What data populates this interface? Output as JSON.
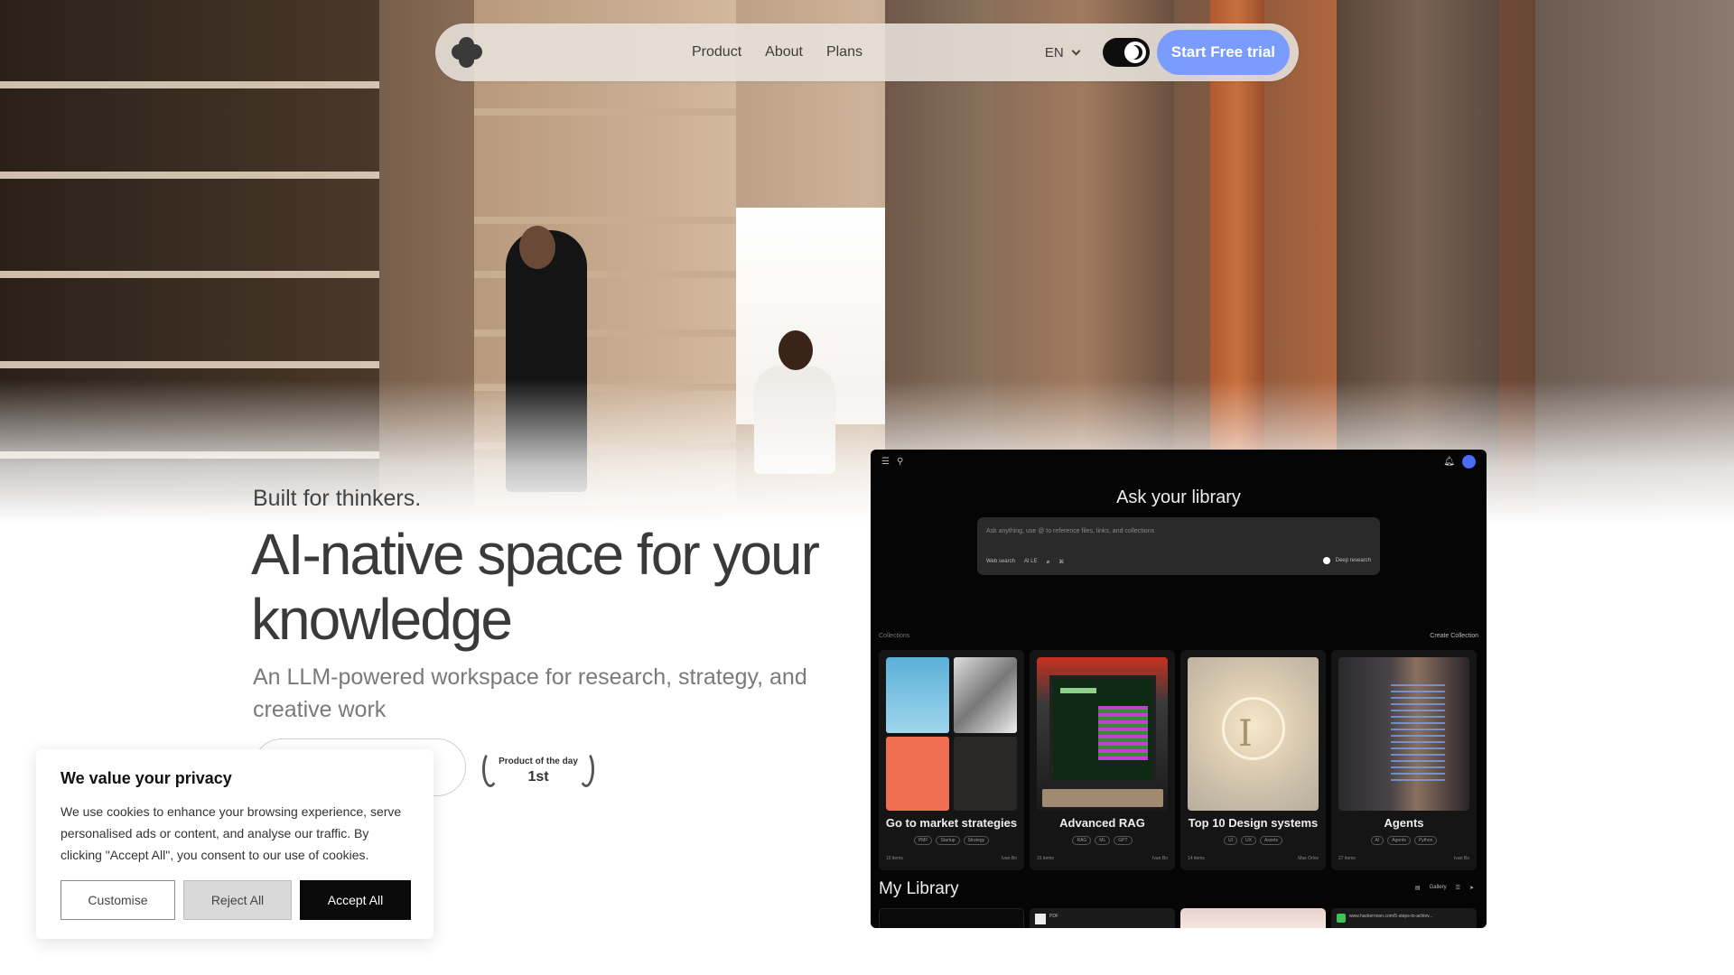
{
  "nav": {
    "links": [
      "Product",
      "About",
      "Plans"
    ],
    "language": "EN",
    "cta_label": "Start Free trial"
  },
  "hero": {
    "eyebrow": "Built for thinkers.",
    "headline": "AI-native space for your knowledge",
    "subtitle": "An LLM-powered workspace for research, strategy, and creative work",
    "award_line1": "Product of the day",
    "award_line2": "1st"
  },
  "app_preview": {
    "ask_title": "Ask your library",
    "ask_placeholder": "Ask anything, use @ to reference files, links, and collections",
    "tools": [
      "Web search",
      "AI LE",
      "⌘"
    ],
    "deep_research": "Deep research",
    "collections_label": "Collections",
    "create_collection": "Create Collection",
    "cards": [
      {
        "title": "Go to market strategies",
        "tags": [
          "PMF",
          "Startup",
          "Strategy"
        ],
        "count": "10 items",
        "owner": "Ivan Bo"
      },
      {
        "title": "Advanced RAG",
        "tags": [
          "RAG",
          "ML",
          "GPT"
        ],
        "count": "15 items",
        "owner": "Ivan Bo"
      },
      {
        "title": "Top 10 Design systems",
        "tags": [
          "UI",
          "UX",
          "Assets"
        ],
        "count": "14 items",
        "owner": "Max Orlov"
      },
      {
        "title": "Agents",
        "tags": [
          "AI",
          "Agents",
          "Python"
        ],
        "count": "27 items",
        "owner": "Ivan Bo"
      }
    ],
    "my_library": "My Library",
    "gallery_label": "Gallery",
    "lib_items": [
      "",
      "PDF",
      "",
      "www.hackernoon.com/5-steps-to-achiev..."
    ]
  },
  "cookie": {
    "title": "We value your privacy",
    "body": "We use cookies to enhance your browsing experience, serve personalised ads or content, and analyse our traffic. By clicking \"Accept All\", you consent to our use of cookies.",
    "customise": "Customise",
    "reject": "Reject All",
    "accept": "Accept All"
  },
  "colors": {
    "accent": "#7a9cff",
    "app_bg": "#050505",
    "accept_bg": "#0a0a0a"
  }
}
